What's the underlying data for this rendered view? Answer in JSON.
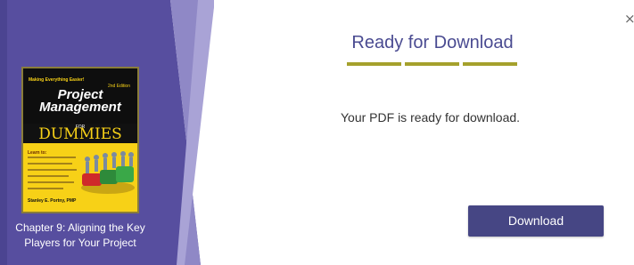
{
  "colors": {
    "panel_purple": "#574e9f",
    "panel_stripe": "#8f88c6",
    "heading": "#4a4b91",
    "divider": "#a5a12c",
    "button": "#464684"
  },
  "left_panel": {
    "book": {
      "tagline": "Making Everything Easier!",
      "edition": "2nd Edition",
      "title_line1": "Project",
      "title_line2": "Management",
      "for_word": "FOR",
      "dummies_word": "DUMMIES",
      "learn_to": "Learn to:",
      "author": "Stanley E. Portny, PMP"
    },
    "chapter_caption": "Chapter 9: Aligning the Key Players for Your Project"
  },
  "dialog": {
    "close_symbol": "×",
    "heading": "Ready for Download",
    "message": "Your PDF is ready for download.",
    "download_label": "Download"
  }
}
